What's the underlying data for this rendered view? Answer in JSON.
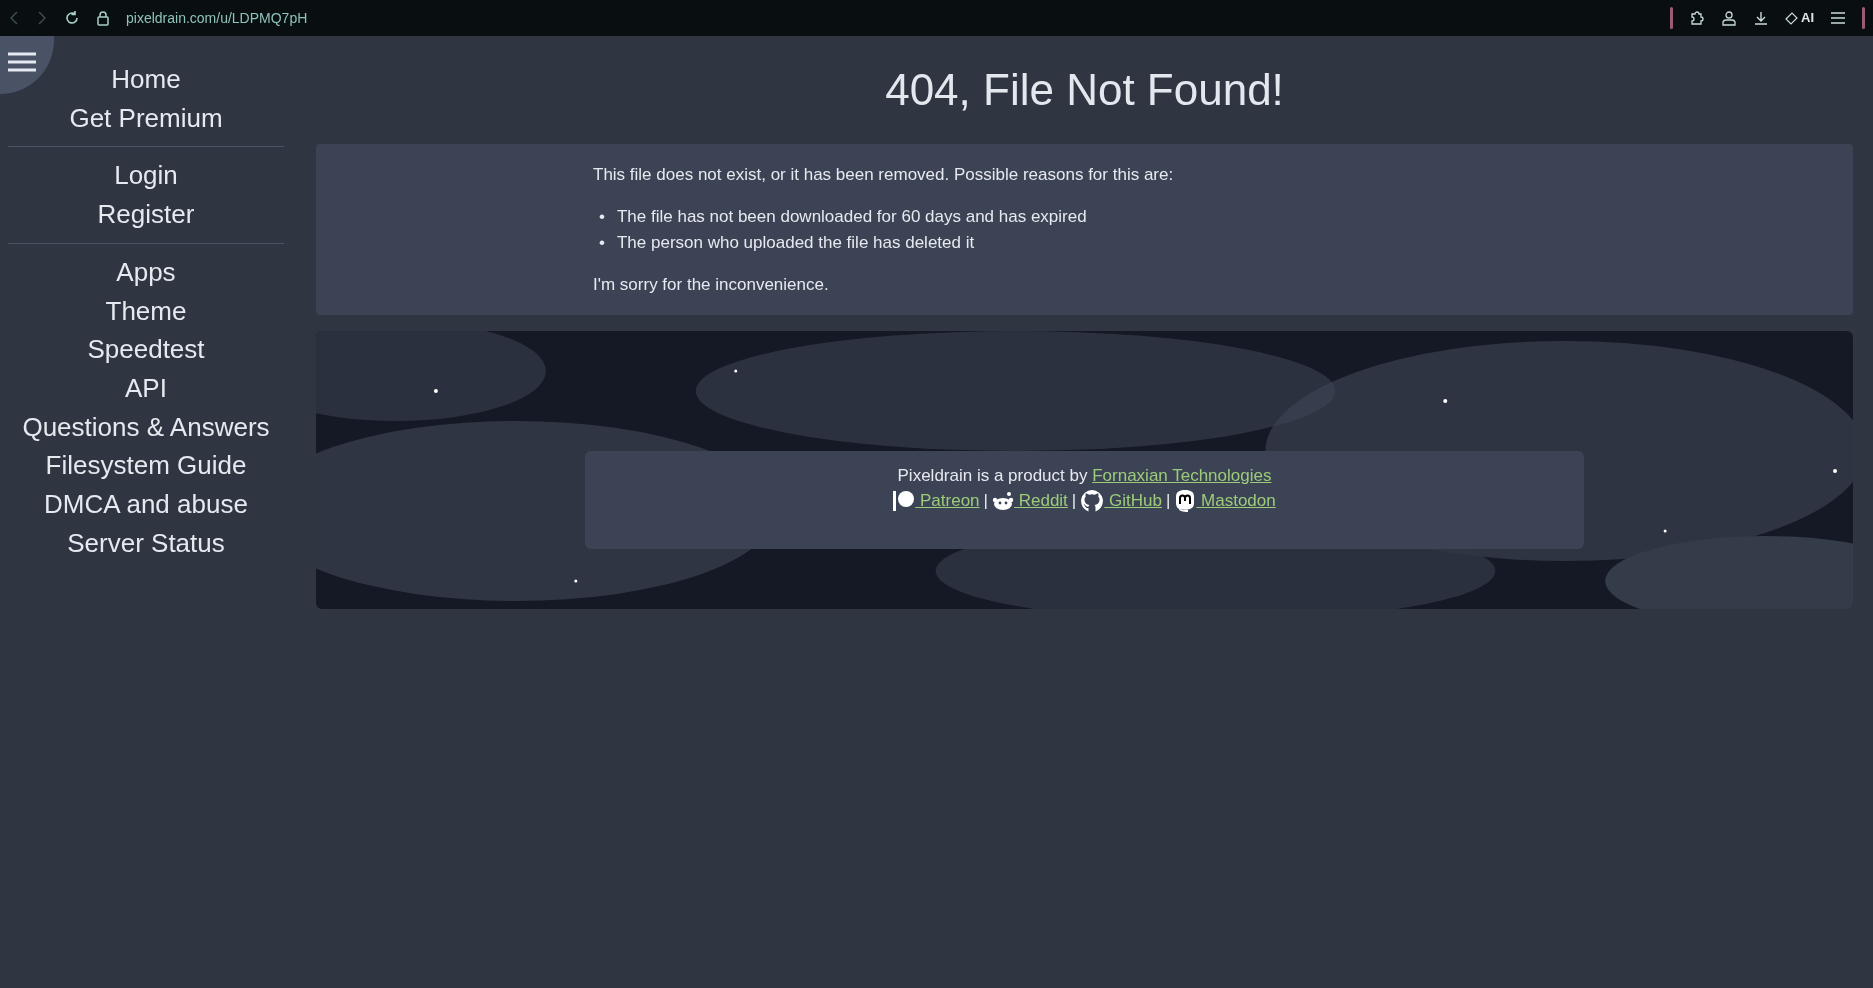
{
  "browser": {
    "url": "pixeldrain.com/u/LDPMQ7pH",
    "ai_label": "AI"
  },
  "sidebar": {
    "groups": [
      [
        "Home",
        "Get Premium"
      ],
      [
        "Login",
        "Register"
      ],
      [
        "Apps",
        "Theme",
        "Speedtest",
        "API",
        "Questions & Answers",
        "Filesystem Guide",
        "DMCA and abuse",
        "Server Status"
      ]
    ]
  },
  "title": "404, File Not Found!",
  "message": {
    "intro": "This file does not exist, or it has been removed. Possible reasons for this are:",
    "bullet": "•",
    "reasons": [
      "The file has not been downloaded for 60 days and has expired",
      "The person who uploaded the file has deleted it"
    ],
    "closing": "I'm sorry for the inconvenience."
  },
  "footer": {
    "text": "Pixeldrain is a product by",
    "company": "Fornaxian Technologies",
    "separator": "|",
    "links": [
      {
        "kind": "patreon",
        "label": " Patreon"
      },
      {
        "kind": "reddit",
        "label": " Reddit"
      },
      {
        "kind": "github",
        "label": " GitHub"
      },
      {
        "kind": "mastodon",
        "label": " Mastodon"
      }
    ]
  }
}
